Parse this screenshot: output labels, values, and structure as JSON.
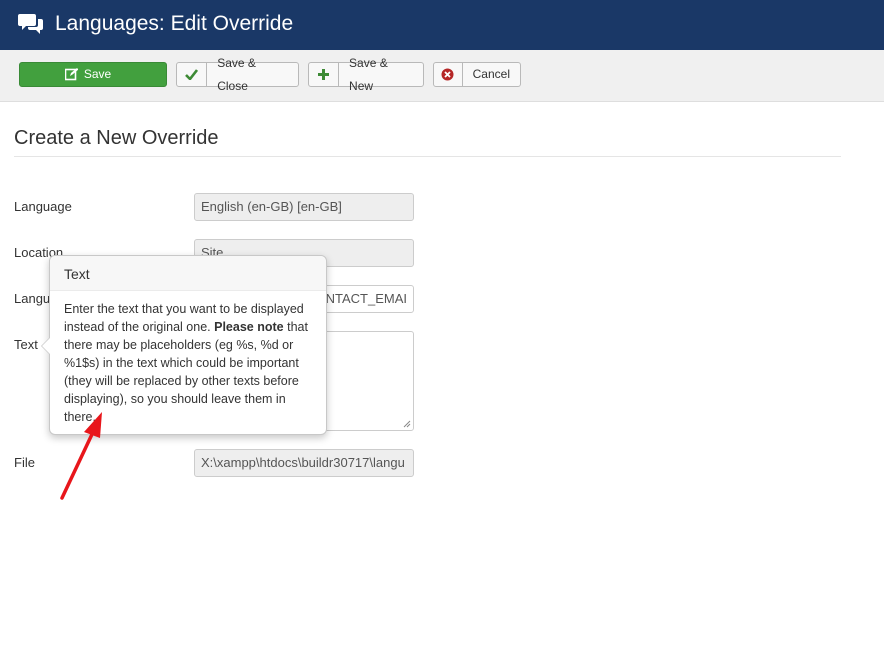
{
  "header": {
    "title": "Languages: Edit Override",
    "icon": "chat-bubbles-icon"
  },
  "toolbar": {
    "save_label": "Save",
    "save_close_label": "Save & Close",
    "save_new_label": "Save & New",
    "cancel_label": "Cancel",
    "colors": {
      "save": "#42a03e",
      "check": "#3d8a35",
      "plus": "#3d8a35",
      "cancel": "#b52727"
    }
  },
  "main": {
    "page_title": "Create a New Override",
    "fields": {
      "language": {
        "label": "Language",
        "value": "English (en-GB) [en-GB]"
      },
      "location": {
        "label": "Location",
        "value": "Site"
      },
      "constant": {
        "label": "Langu",
        "value": "ONTACT_EMAI"
      },
      "text": {
        "label": "Text",
        "value": ""
      },
      "file": {
        "label": "File",
        "value": "X:\\xampp\\htdocs\\buildr30717\\langu"
      }
    }
  },
  "popover": {
    "title": "Text",
    "body_intro": "Enter the text that you want to be displayed instead of the original one.",
    "body_bold": "Please note",
    "body_rest": "that there may be placeholders (eg %s, %d or %1$s) in the text which could be important (they will be replaced by other texts before displaying), so you should leave them in there."
  },
  "annotation": {
    "color": "#e8161b"
  },
  "colors": {
    "header_bg": "#1a3867",
    "toolbar_bg": "#f0f0f0"
  }
}
